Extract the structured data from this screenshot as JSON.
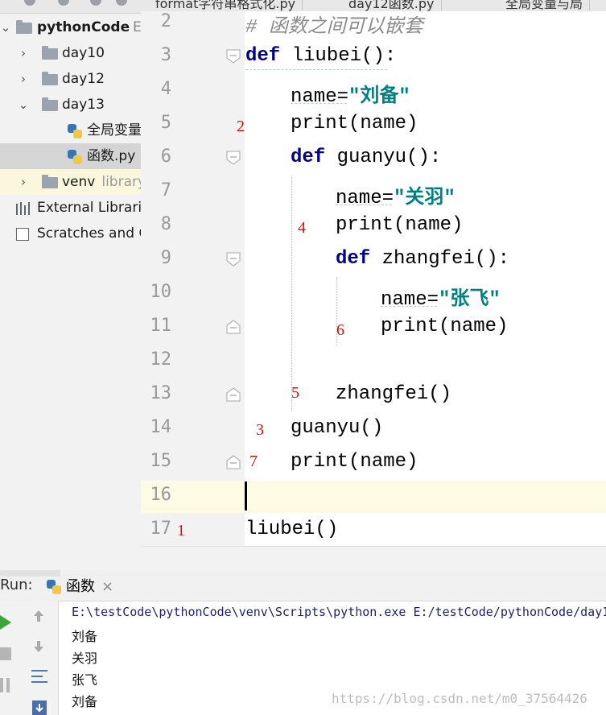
{
  "tabs": [
    {
      "label": "format字符串格式化.py"
    },
    {
      "label": "day12函数.py"
    },
    {
      "label": "全局变量与局"
    }
  ],
  "project": {
    "root": {
      "label": "pythonCode",
      "suffix": "E"
    },
    "items": [
      {
        "label": "day10",
        "type": "folder",
        "expanded": false
      },
      {
        "label": "day12",
        "type": "folder",
        "expanded": false
      },
      {
        "label": "day13",
        "type": "folder",
        "expanded": true
      },
      {
        "label": "全局变量",
        "type": "python-file"
      },
      {
        "label": "函数.py",
        "type": "python-file",
        "selected": true
      },
      {
        "label": "venv",
        "sub": "library",
        "type": "folder",
        "expanded": false
      },
      {
        "label": "External Librari",
        "type": "libraries"
      },
      {
        "label": "Scratches and C",
        "type": "scratches"
      }
    ]
  },
  "editor": {
    "lines": [
      {
        "n": "2",
        "comment": "# 函数之间可以嵌套"
      },
      {
        "n": "3",
        "kw": "def",
        "rest": " liubei():"
      },
      {
        "n": "4",
        "pre": "name=",
        "str": "\"刘备\""
      },
      {
        "n": "5",
        "pre": "print(name)"
      },
      {
        "n": "6",
        "kw": "def",
        "rest": " guanyu():"
      },
      {
        "n": "7",
        "pre": "name=",
        "str": "\"关羽\""
      },
      {
        "n": "8",
        "pre": "print(name)"
      },
      {
        "n": "9",
        "kw": "def",
        "rest": " zhangfei():"
      },
      {
        "n": "10",
        "pre": "name=",
        "str": "\"张飞\""
      },
      {
        "n": "11",
        "pre": "print(name)"
      },
      {
        "n": "12",
        "pre": ""
      },
      {
        "n": "13",
        "pre": "zhangfei()"
      },
      {
        "n": "14",
        "pre": "guanyu()"
      },
      {
        "n": "15",
        "pre": "print(name)"
      },
      {
        "n": "16",
        "pre": ""
      },
      {
        "n": "17",
        "pre": "liubei()"
      }
    ],
    "annotations": [
      "2",
      "4",
      "6",
      "5",
      "3",
      "7",
      "1"
    ]
  },
  "run": {
    "label": "Run:",
    "tab_label": "函数",
    "close": "×",
    "command": "E:\\testCode\\pythonCode\\venv\\Scripts\\python.exe E:/testCode/pythonCode/day1",
    "output": [
      "刘备",
      "关羽",
      "张飞",
      "刘备"
    ]
  },
  "watermark": "https://blog.csdn.net/m0_37564426",
  "colors": {
    "keyword": "#000080",
    "string": "#008080",
    "annotation": "#d01010",
    "current_line": "#fdfbe3"
  }
}
